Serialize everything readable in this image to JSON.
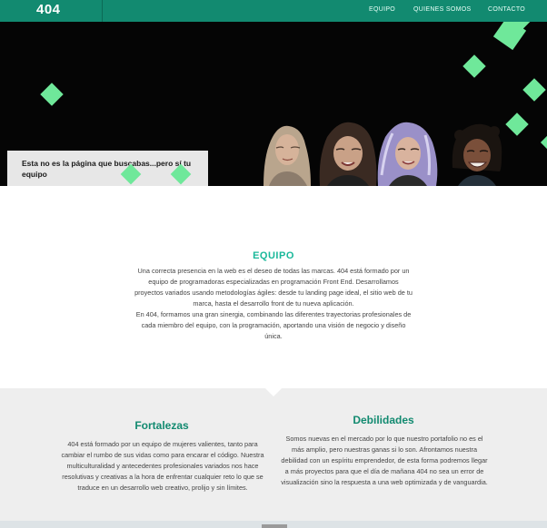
{
  "header": {
    "logo": "404",
    "nav": [
      "EQUIPO",
      "QUIENES SOMOS",
      "CONTACTO"
    ],
    "bg_color": "#128a70"
  },
  "hero": {
    "caption": "Esta no es la página que buscabas...pero sí tu equipo",
    "accent_color": "#6fe89a",
    "bg_color": "#050505"
  },
  "equipo": {
    "title": "EQUIPO",
    "paragraphs": [
      "Una correcta presencia en la web es el deseo de todas las marcas. 404 está formado por un equipo de programadoras especializadas en programación Front End. Desarrollamos proyectos variados usando metodologías ágiles: desde tu landing page ideal, el sitio web de tu marca, hasta el desarrollo front de tu nueva aplicación.",
      "En 404, formamos una gran sinergia, combinando las diferentes trayectorias profesionales de cada miembro del equipo, con la programación, aportando una visión de negocio y diseño única."
    ]
  },
  "fortalezas": {
    "title": "Fortalezas",
    "text": "404 está formado por un equipo de mujeres valientes, tanto para cambiar el rumbo de sus vidas como para encarar el código. Nuestra multiculturalidad y antecedentes profesionales variados nos hace resolutivas y creativas a la hora de enfrentar cualquier reto lo que se traduce en un desarrollo web creativo, prolijo y sin límites."
  },
  "debilidades": {
    "title": "Debilidades",
    "text": "Somos nuevas en el mercado por lo que nuestro portafolio no es el más amplio, pero nuestras ganas si lo son. Afrontamos nuestra debilidad con un espíritu emprendedor, de esta forma podremos llegar a más proyectos para que el día de mañana 404 no sea un error de visualización sino la respuesta a una web optimizada y de vanguardia."
  }
}
